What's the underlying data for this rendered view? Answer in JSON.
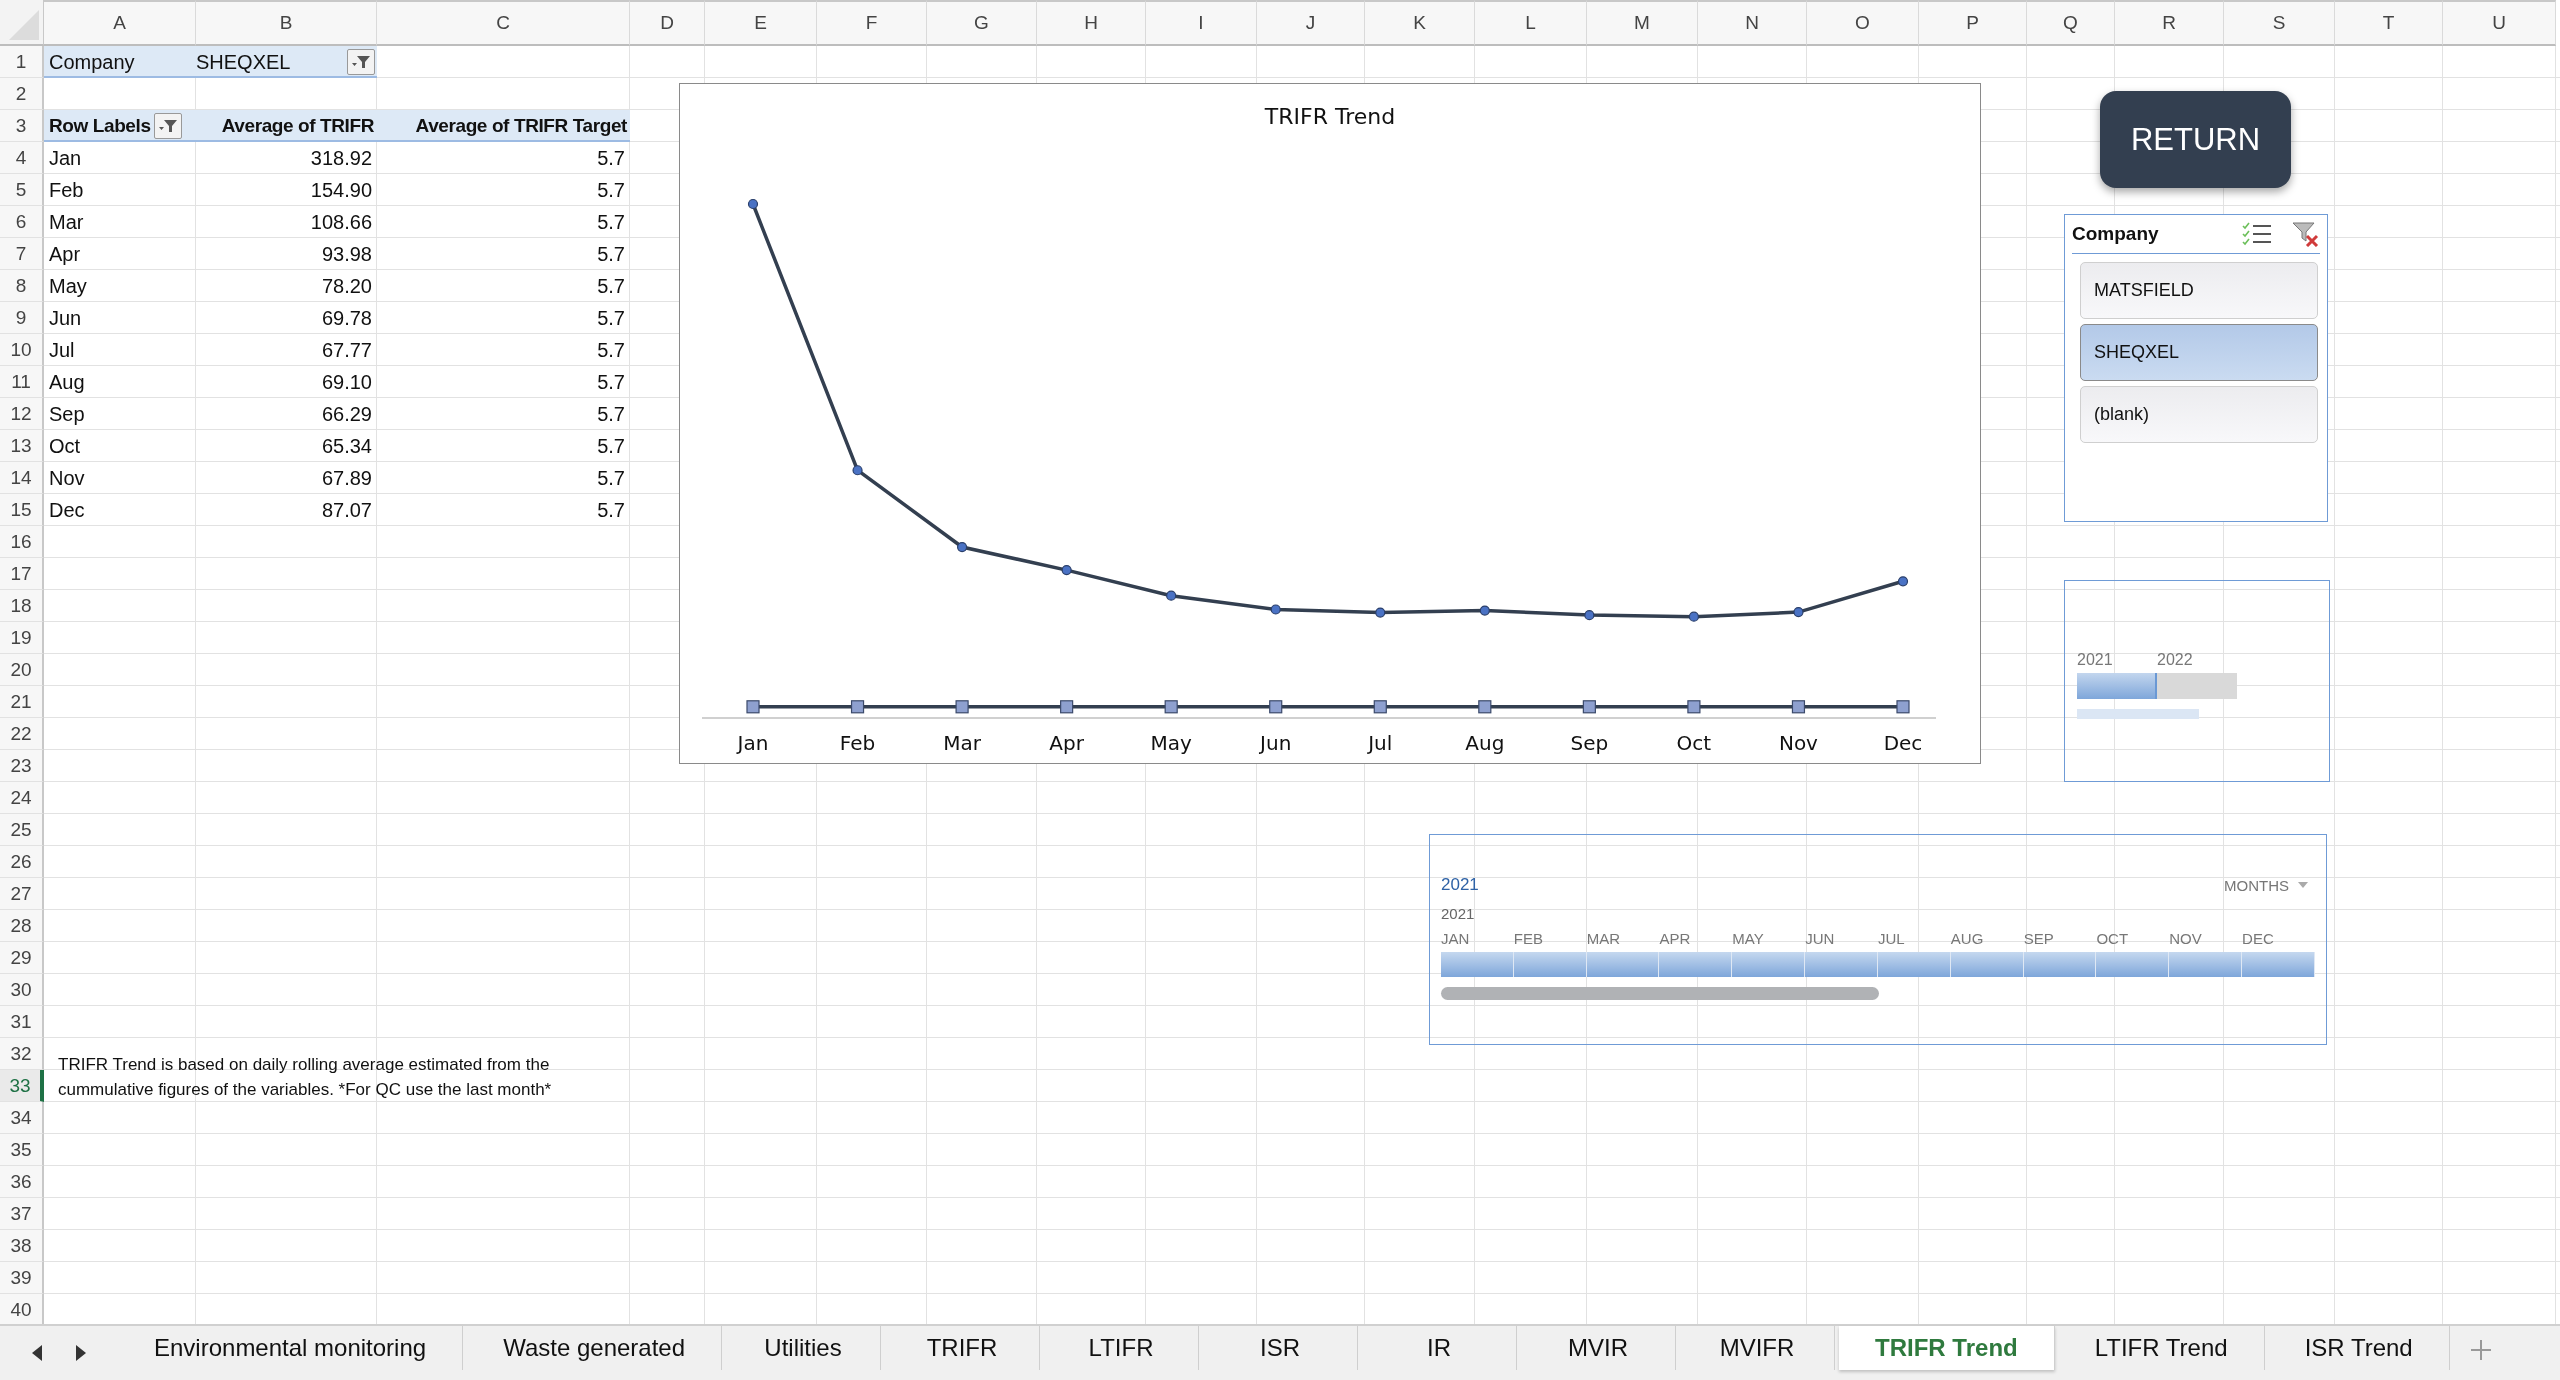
{
  "columns": [
    "A",
    "B",
    "C",
    "D",
    "E",
    "F",
    "G",
    "H",
    "I",
    "J",
    "K",
    "L",
    "M",
    "N",
    "O",
    "P",
    "Q",
    "R",
    "S",
    "T",
    "U"
  ],
  "row_headers": [
    {
      "label": "1",
      "selected": false
    },
    {
      "label": "2",
      "selected": false
    },
    {
      "label": "3",
      "selected": false
    },
    {
      "label": "4",
      "selected": false
    },
    {
      "label": "5",
      "selected": false
    },
    {
      "label": "6",
      "selected": false
    },
    {
      "label": "7",
      "selected": false
    },
    {
      "label": "8",
      "selected": false
    },
    {
      "label": "9",
      "selected": false
    },
    {
      "label": "10",
      "selected": false
    },
    {
      "label": "11",
      "selected": false
    },
    {
      "label": "12",
      "selected": false
    },
    {
      "label": "13",
      "selected": false
    },
    {
      "label": "14",
      "selected": false
    },
    {
      "label": "15",
      "selected": false
    },
    {
      "label": "16",
      "selected": false
    },
    {
      "label": "17",
      "selected": false
    },
    {
      "label": "18",
      "selected": false
    },
    {
      "label": "19",
      "selected": false
    },
    {
      "label": "20",
      "selected": false
    },
    {
      "label": "21",
      "selected": false
    },
    {
      "label": "22",
      "selected": false
    },
    {
      "label": "23",
      "selected": false
    },
    {
      "label": "24",
      "selected": false
    },
    {
      "label": "25",
      "selected": false
    },
    {
      "label": "26",
      "selected": false
    },
    {
      "label": "27",
      "selected": false
    },
    {
      "label": "28",
      "selected": false
    },
    {
      "label": "29",
      "selected": false
    },
    {
      "label": "30",
      "selected": false
    },
    {
      "label": "31",
      "selected": false
    },
    {
      "label": "32",
      "selected": false
    },
    {
      "label": "33",
      "selected": true
    },
    {
      "label": "34",
      "selected": false
    },
    {
      "label": "35",
      "selected": false
    },
    {
      "label": "36",
      "selected": false
    },
    {
      "label": "37",
      "selected": false
    },
    {
      "label": "38",
      "selected": false
    },
    {
      "label": "39",
      "selected": false
    },
    {
      "label": "40",
      "selected": false
    }
  ],
  "report_filter": {
    "label": "Company",
    "value": "SHEQXEL"
  },
  "pivot": {
    "headers": [
      "Row Labels",
      "Average of TRIFR",
      "Average of TRIFR Target"
    ],
    "rows": [
      {
        "label": "Jan",
        "average": "318.92",
        "target": "5.7"
      },
      {
        "label": "Feb",
        "average": "154.90",
        "target": "5.7"
      },
      {
        "label": "Mar",
        "average": "108.66",
        "target": "5.7"
      },
      {
        "label": "Apr",
        "average": "93.98",
        "target": "5.7"
      },
      {
        "label": "May",
        "average": "78.20",
        "target": "5.7"
      },
      {
        "label": "Jun",
        "average": "69.78",
        "target": "5.7"
      },
      {
        "label": "Jul",
        "average": "67.77",
        "target": "5.7"
      },
      {
        "label": "Aug",
        "average": "69.10",
        "target": "5.7"
      },
      {
        "label": "Sep",
        "average": "66.29",
        "target": "5.7"
      },
      {
        "label": "Oct",
        "average": "65.34",
        "target": "5.7"
      },
      {
        "label": "Nov",
        "average": "67.89",
        "target": "5.7"
      },
      {
        "label": "Dec",
        "average": "87.07",
        "target": "5.7"
      }
    ]
  },
  "note": "TRIFR Trend is based on daily rolling average estimated from the cummulative figures of the variables. *For QC use the last month*",
  "chart": {
    "title": "TRIFR Trend",
    "x_labels": [
      "Jan",
      "Feb",
      "Mar",
      "Apr",
      "May",
      "Jun",
      "Jul",
      "Aug",
      "Sep",
      "Oct",
      "Nov",
      "Dec"
    ]
  },
  "return_button": "RETURN",
  "company_slicer": {
    "title": "Company",
    "items": [
      {
        "label": "MATSFIELD",
        "selected": false
      },
      {
        "label": "SHEQXEL",
        "selected": true
      },
      {
        "label": "(blank)",
        "selected": false
      }
    ]
  },
  "year_slicer": {
    "items": [
      {
        "label": "2021",
        "selected": true
      },
      {
        "label": "2022",
        "selected": false
      }
    ]
  },
  "timeline": {
    "selection": "2021",
    "level": "MONTHS",
    "year": "2021",
    "months": [
      {
        "label": "JAN",
        "selected": true
      },
      {
        "label": "FEB",
        "selected": true
      },
      {
        "label": "MAR",
        "selected": true
      },
      {
        "label": "APR",
        "selected": true
      },
      {
        "label": "MAY",
        "selected": true
      },
      {
        "label": "JUN",
        "selected": true
      },
      {
        "label": "JUL",
        "selected": true
      },
      {
        "label": "AUG",
        "selected": true
      },
      {
        "label": "SEP",
        "selected": true
      },
      {
        "label": "OCT",
        "selected": true
      },
      {
        "label": "NOV",
        "selected": true
      },
      {
        "label": "DEC",
        "selected": true
      }
    ]
  },
  "sheet_tabs": [
    {
      "label": "Environmental monitoring",
      "selected": false
    },
    {
      "label": "Waste generated",
      "selected": false
    },
    {
      "label": "Utilities",
      "selected": false
    },
    {
      "label": "TRIFR",
      "selected": false
    },
    {
      "label": "LTIFR",
      "selected": false
    },
    {
      "label": "ISR",
      "selected": false
    },
    {
      "label": "IR",
      "selected": false
    },
    {
      "label": "MVIR",
      "selected": false
    },
    {
      "label": "MVIFR",
      "selected": false
    },
    {
      "label": "TRIFR Trend",
      "selected": true
    },
    {
      "label": "LTIFR Trend",
      "selected": false
    },
    {
      "label": "ISR Trend",
      "selected": false
    }
  ]
}
